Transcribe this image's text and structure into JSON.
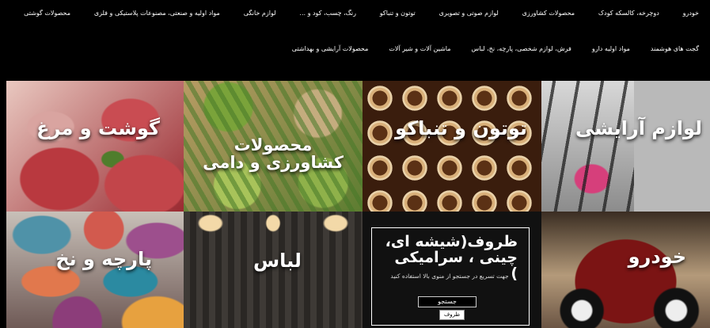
{
  "nav": {
    "row1": [
      "خودرو",
      "دوچرخه، کالسکه کودک",
      "محصولات کشاورزی",
      "لوازم صوتی و تصویری",
      "توتون و تنباکو",
      "رنگ، چسب، کود و ...",
      "لوازم خانگی",
      "مواد اولیه و صنعتی، مصنوعات پلاستیکی و فلزی",
      "محصولات گوشتی"
    ],
    "row2": [
      "گجت های هوشمند",
      "مواد اولیه دارو",
      "فرش، لوازم شخصی، پارچه، نخ، لباس",
      "ماشین آلات و شیر آلات",
      "محصولات آرایشی و بهداشتی"
    ]
  },
  "tiles": {
    "meat": "گوشت و مرغ",
    "agriculture": "محصولات کشاورزی و دامی",
    "tobacco": "توتون و تنباکو",
    "cosmetics": "لوازم آرایشی",
    "fabric": "پارچه و نخ",
    "clothing": "لباس",
    "dishes": {
      "title": "ظروف(شیشه ای، چینی ، سرامیکی )",
      "hint": "جهت تسریع در جستجو از منوی بالا استفاده کنید",
      "search_value": "جستجو",
      "button_label": "ظروف"
    },
    "car": "خودرو"
  }
}
